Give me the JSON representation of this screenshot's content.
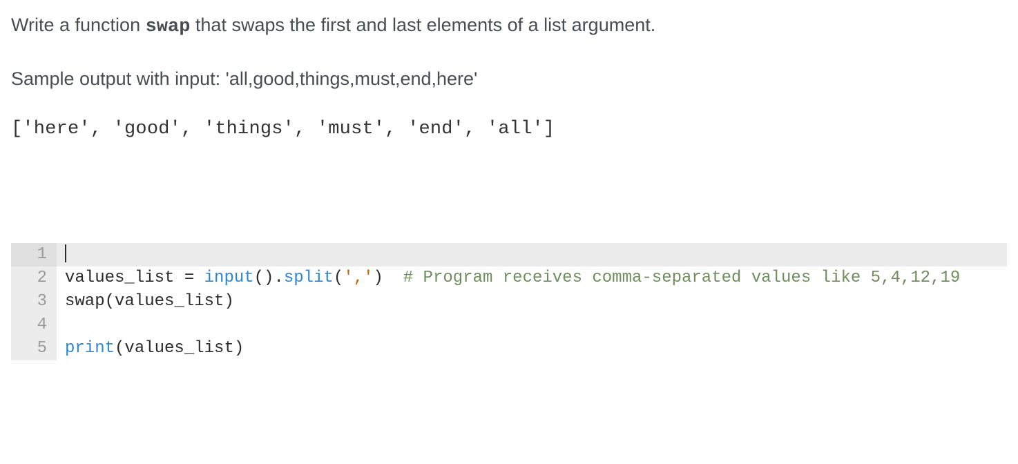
{
  "prompt": {
    "prefix": "Write a function ",
    "code": "swap",
    "suffix": " that swaps the first and last elements of a list argument."
  },
  "sample_label": "Sample output with input: 'all,good,things,must,end,here'",
  "sample_output": "['here', 'good', 'things', 'must', 'end', 'all']",
  "code": {
    "lines": [
      {
        "n": "1"
      },
      {
        "n": "2",
        "t_id1": "values_list ",
        "t_op1": "= ",
        "t_fn1": "input",
        "t_op2": "().",
        "t_fn2": "split",
        "t_op3": "(",
        "t_str1": "','",
        "t_op4": ")  ",
        "t_cmt": "# Program receives comma-separated values like 5,4,12,19"
      },
      {
        "n": "3",
        "t_id1": "swap(values_list)"
      },
      {
        "n": "4"
      },
      {
        "n": "5",
        "t_fn1": "print",
        "t_op1": "(values_list)"
      }
    ]
  }
}
